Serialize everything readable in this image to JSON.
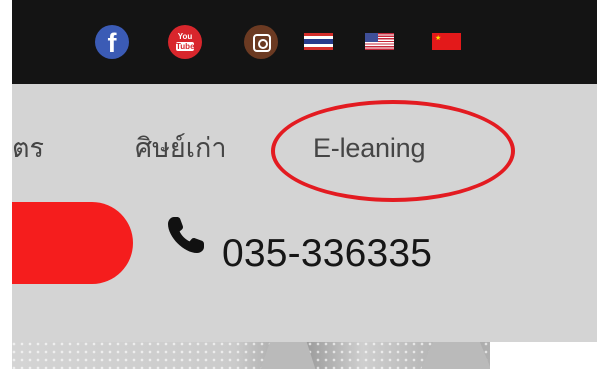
{
  "social": {
    "facebook_glyph": "f",
    "youtube_line1": "You",
    "youtube_line2": "Tube"
  },
  "languages": {
    "th": "Thai",
    "en": "English",
    "zh": "Chinese"
  },
  "menu": {
    "partial_label": "ตร",
    "alumni_label": "ศิษย์เก่า",
    "elearning_label": "E-leaning"
  },
  "contact": {
    "phone_icon": "phone-icon",
    "phone_number": "035-336335"
  },
  "colors": {
    "topbar": "#141414",
    "menu_background": "#d4d4d4",
    "highlight": "#e31b21",
    "pill": "#f51d1d",
    "facebook": "#3b5bb5",
    "youtube": "#d8262c",
    "instagram": "#6b3a22"
  }
}
